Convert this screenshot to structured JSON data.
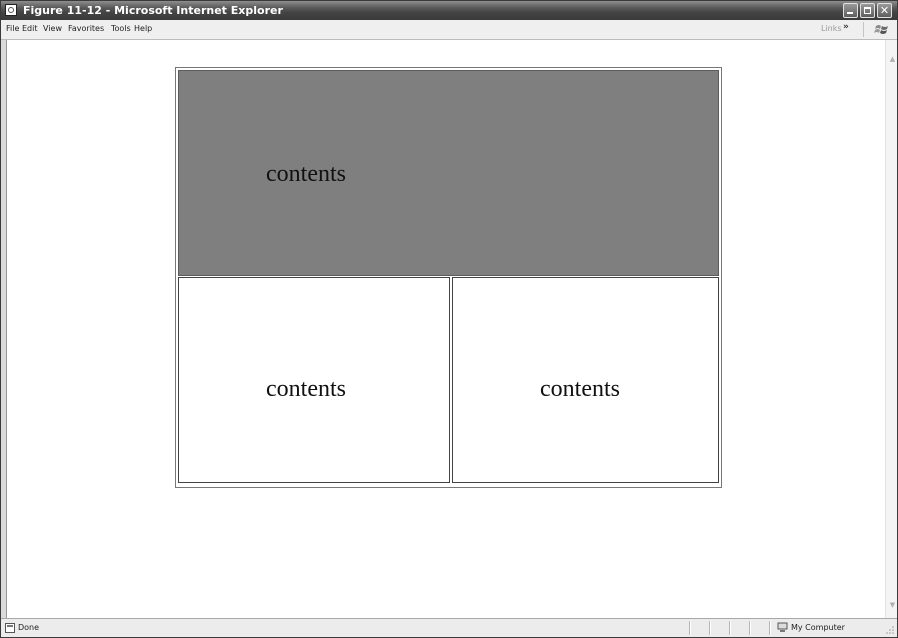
{
  "window": {
    "title": "Figure 11-12 - Microsoft Internet Explorer"
  },
  "menu": {
    "items": [
      "File",
      "Edit",
      "View",
      "Favorites",
      "Tools",
      "Help"
    ],
    "links_label": "Links",
    "links_chevron": "»"
  },
  "frames": {
    "top": {
      "text": "contents",
      "background": "#7f7f7f"
    },
    "bottom_left": {
      "text": "contents"
    },
    "bottom_right": {
      "text": "contents"
    }
  },
  "status": {
    "text": "Done",
    "zone": "My Computer"
  },
  "icons": {
    "app": "ie-page-icon",
    "windows_logo": "windows-flag-icon",
    "status": "page-done-icon",
    "zone": "my-computer-icon"
  }
}
